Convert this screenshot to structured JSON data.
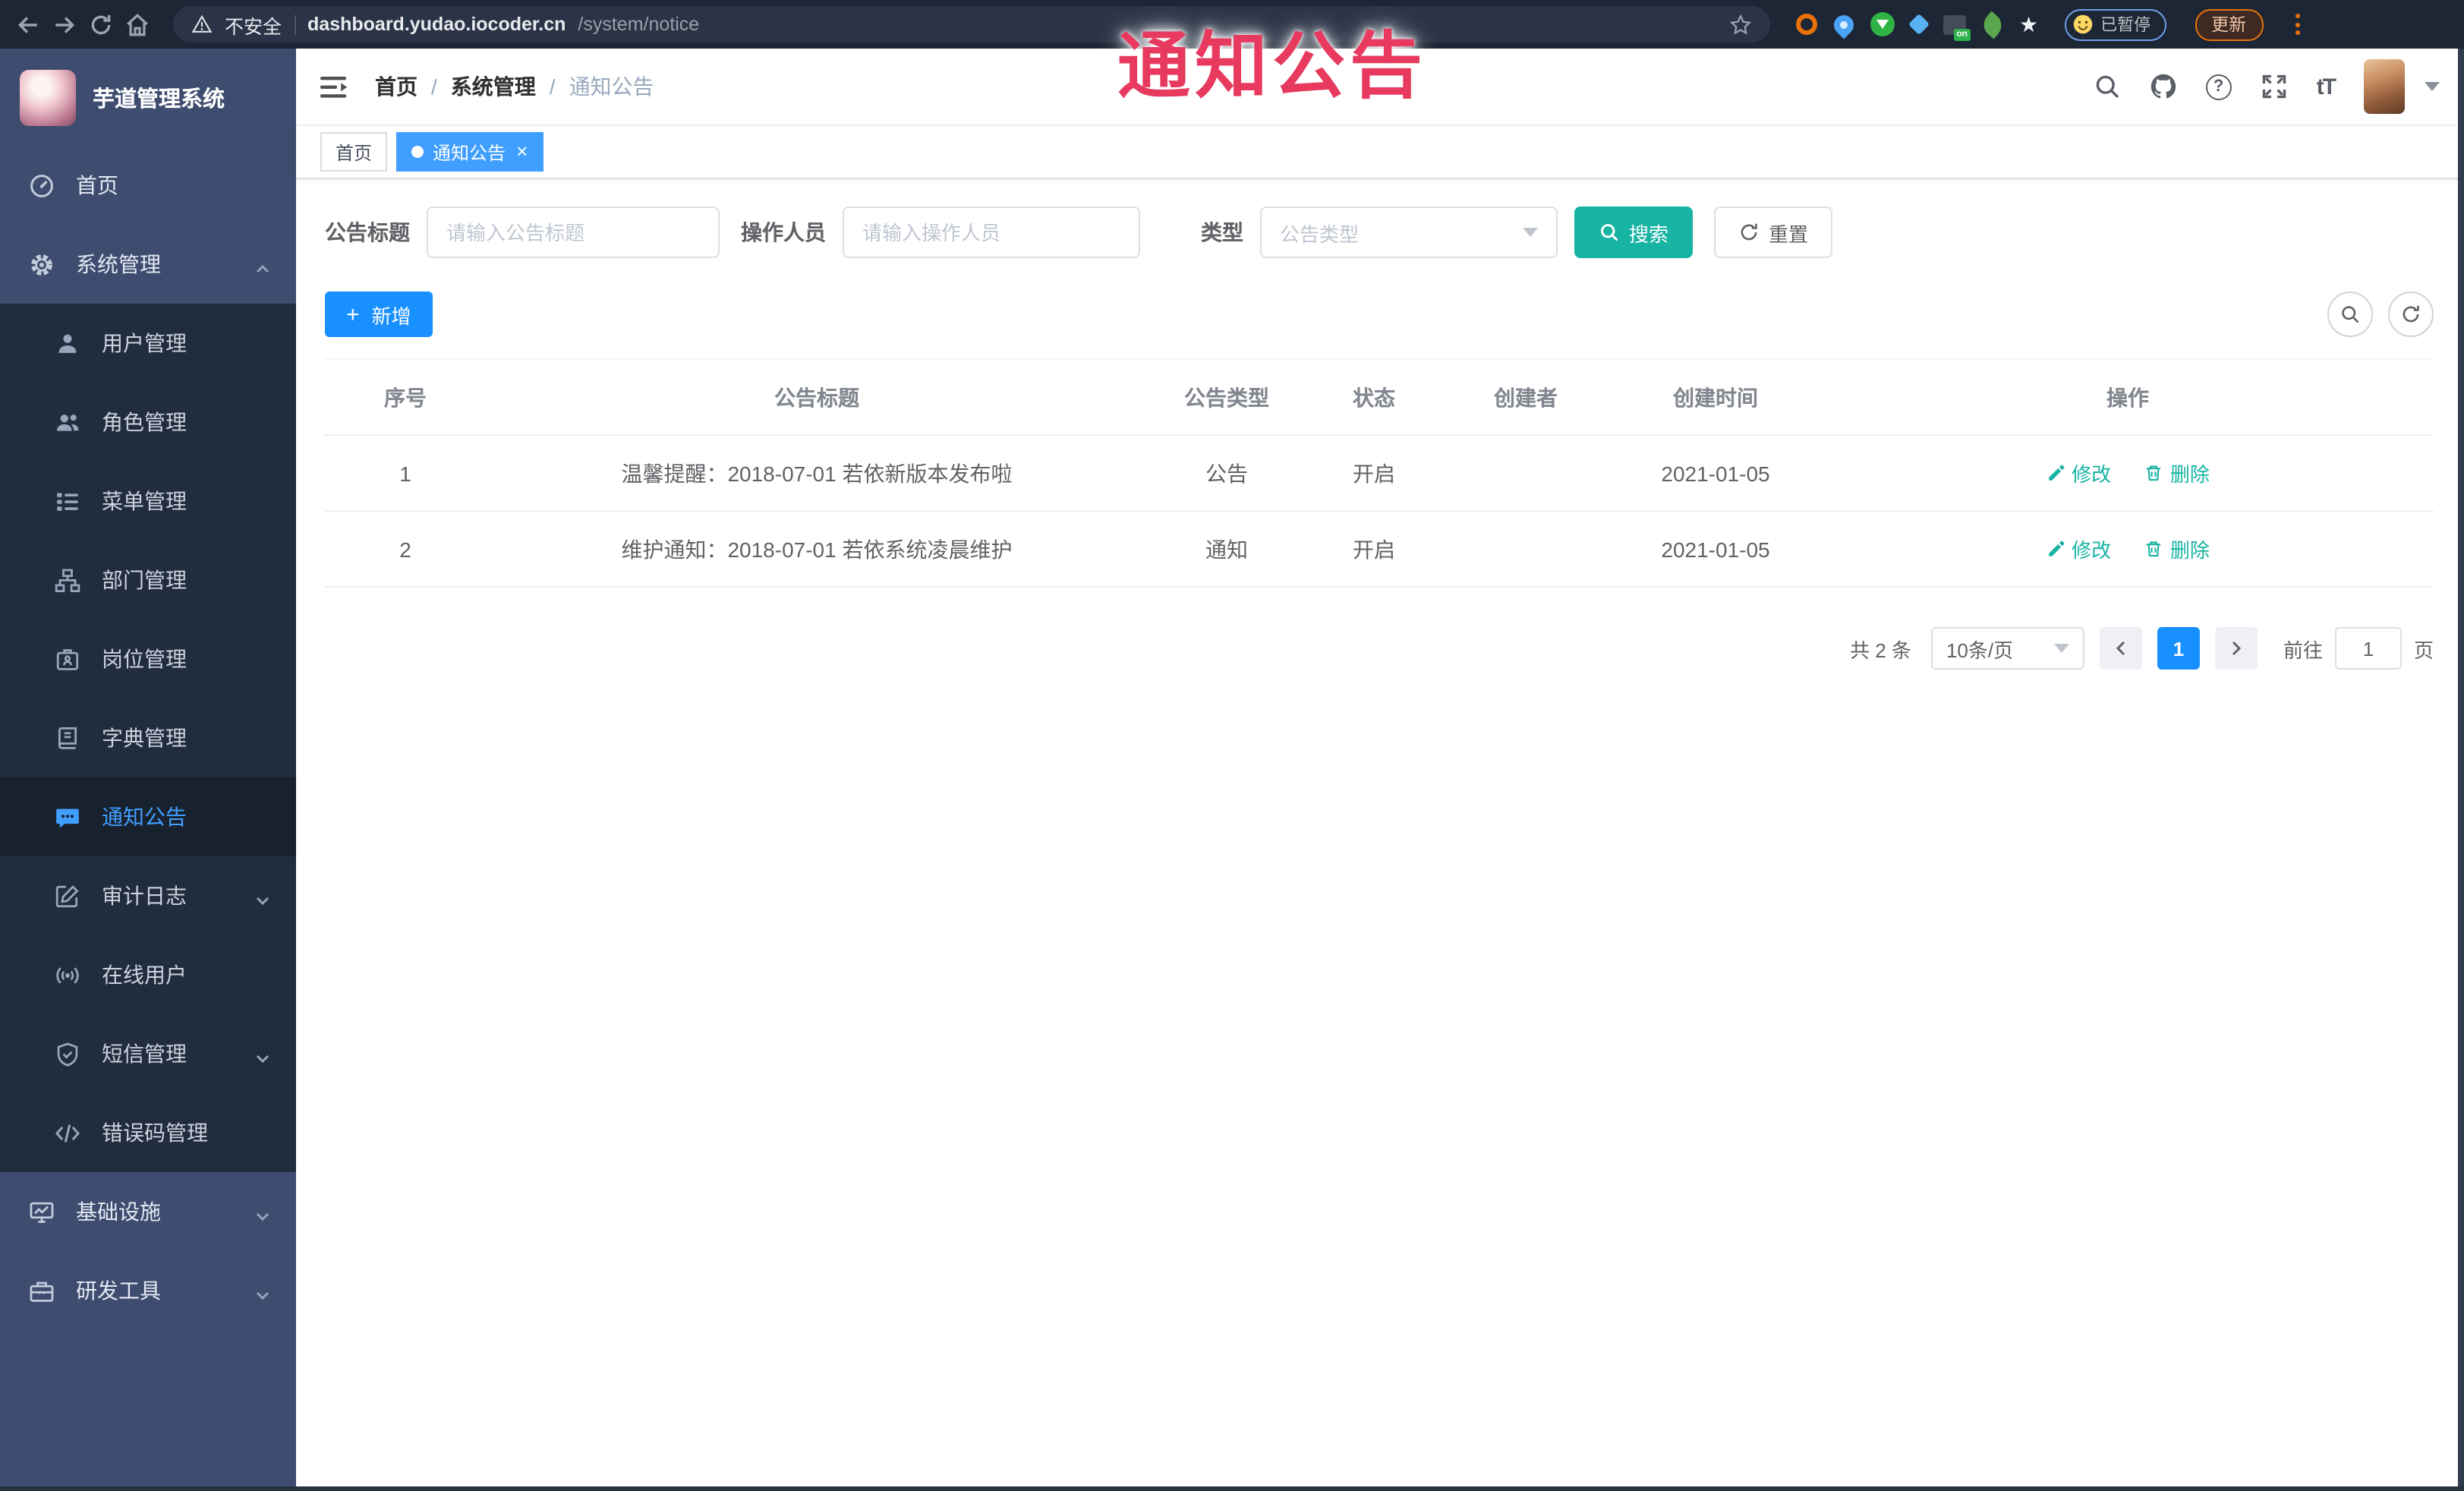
{
  "colors": {
    "accent_blue": "#409eff",
    "button_blue": "#1890ff",
    "teal_primary": "#17b3a3",
    "overlay_red": "#e8395f",
    "sidebar_bg": "#3e4c6f",
    "submenu_bg": "#212c3d",
    "chrome_bg": "#1d2634",
    "update_orange": "#e8710a"
  },
  "overlay": {
    "title": "通知公告"
  },
  "browser": {
    "security_label": "不安全",
    "url_host": "dashboard.yudao.iocoder.cn",
    "url_path": "/system/notice",
    "proxy_badge": "on",
    "paused_label": "已暂停",
    "update_label": "更新"
  },
  "icons": {
    "plus": "+",
    "close": "×",
    "star": "★",
    "font_size": "tT",
    "question": "?"
  },
  "sidebar": {
    "logo_title": "芋道管理系统",
    "items": [
      {
        "label": "首页"
      },
      {
        "label": "系统管理"
      },
      {
        "label": "用户管理"
      },
      {
        "label": "角色管理"
      },
      {
        "label": "菜单管理"
      },
      {
        "label": "部门管理"
      },
      {
        "label": "岗位管理"
      },
      {
        "label": "字典管理"
      },
      {
        "label": "通知公告"
      },
      {
        "label": "审计日志"
      },
      {
        "label": "在线用户"
      },
      {
        "label": "短信管理"
      },
      {
        "label": "错误码管理"
      },
      {
        "label": "基础设施"
      },
      {
        "label": "研发工具"
      }
    ]
  },
  "navbar": {
    "breadcrumb": [
      {
        "label": "首页"
      },
      {
        "label": "系统管理"
      },
      {
        "label": "通知公告"
      }
    ],
    "separator": "/"
  },
  "tags": [
    {
      "label": "首页"
    },
    {
      "label": "通知公告"
    }
  ],
  "filters": {
    "title_label": "公告标题",
    "title_placeholder": "请输入公告标题",
    "operator_label": "操作人员",
    "operator_placeholder": "请输入操作人员",
    "type_label": "类型",
    "type_placeholder": "公告类型",
    "search_label": "搜索",
    "reset_label": "重置"
  },
  "toolbar": {
    "add_label": "新增"
  },
  "table": {
    "columns": [
      "序号",
      "公告标题",
      "公告类型",
      "状态",
      "创建者",
      "创建时间",
      "操作"
    ],
    "rows": [
      {
        "index": "1",
        "title": "温馨提醒：2018-07-01 若依新版本发布啦",
        "type": "公告",
        "status": "开启",
        "creator": "",
        "created_at": "2021-01-05"
      },
      {
        "index": "2",
        "title": "维护通知：2018-07-01 若依系统凌晨维护",
        "type": "通知",
        "status": "开启",
        "creator": "",
        "created_at": "2021-01-05"
      }
    ],
    "edit_label": "修改",
    "delete_label": "删除"
  },
  "pagination": {
    "total": "共 2 条",
    "page_size": "10条/页",
    "page": "1",
    "goto_label": "前往",
    "goto_value": "1",
    "unit_label": "页"
  }
}
